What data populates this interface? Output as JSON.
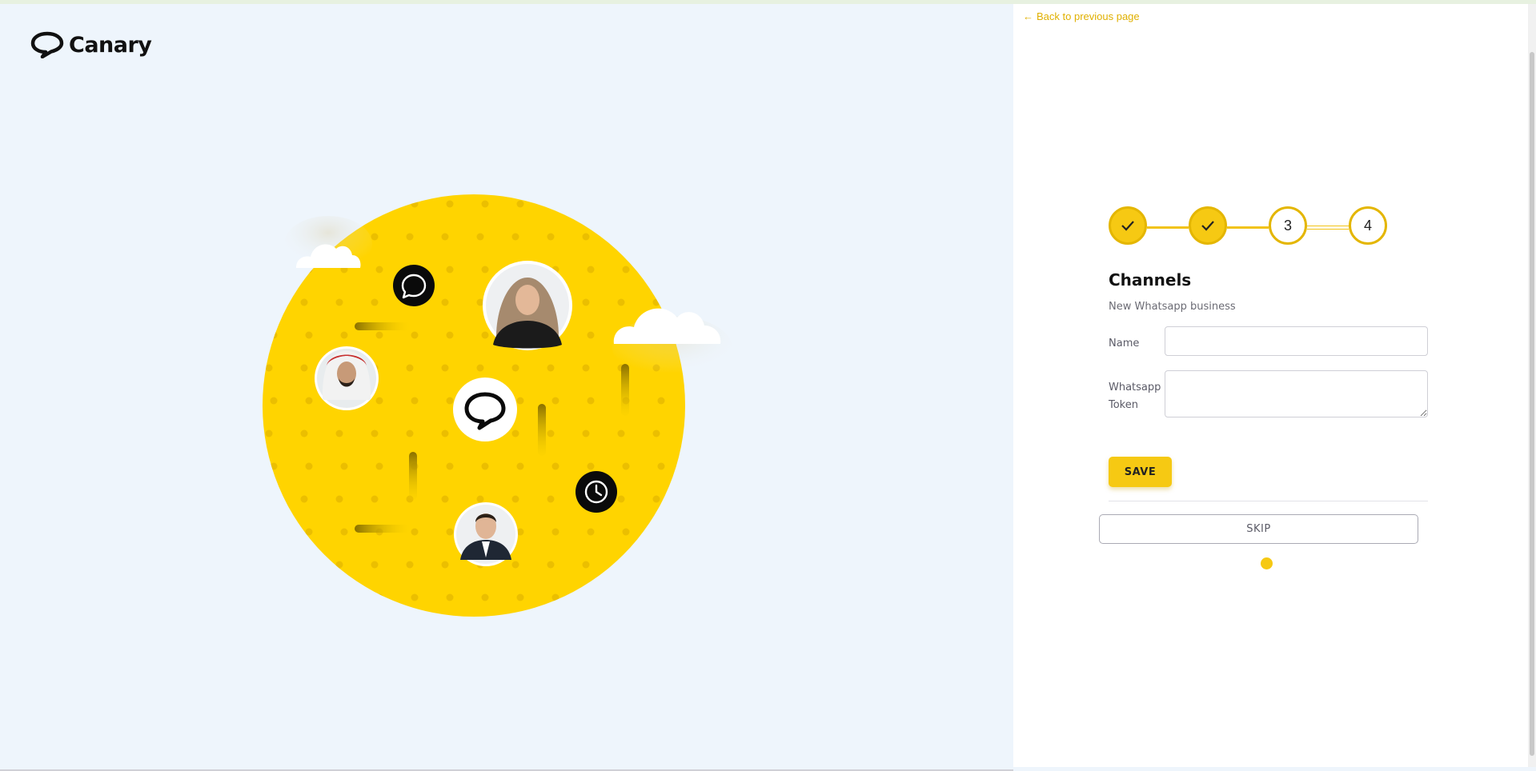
{
  "brand": {
    "name": "Canary",
    "accent_color": "#f6c913"
  },
  "nav": {
    "back_label": "Back to previous page",
    "back_icon": "arrow-left-icon"
  },
  "stepper": {
    "steps": [
      {
        "label": "",
        "status": "done"
      },
      {
        "label": "",
        "status": "done"
      },
      {
        "label": "3",
        "status": "pending"
      },
      {
        "label": "4",
        "status": "pending"
      }
    ]
  },
  "form": {
    "title": "Channels",
    "subtitle": "New Whatsapp business",
    "fields": {
      "name": {
        "label": "Name",
        "value": "",
        "placeholder": ""
      },
      "token": {
        "label_line1": "Whatsapp",
        "label_line2": "Token",
        "value": "",
        "placeholder": ""
      }
    },
    "save_label": "SAVE",
    "skip_label": "SKIP"
  }
}
